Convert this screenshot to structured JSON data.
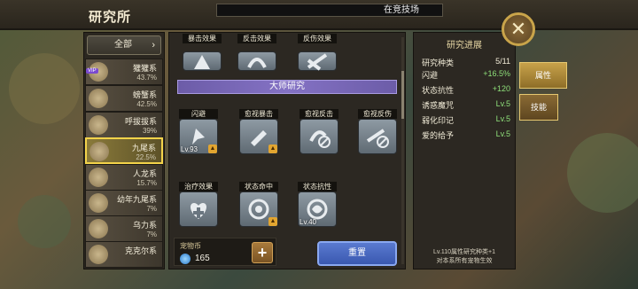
{
  "header": {
    "title": "研究所",
    "location": "在竞技场",
    "close_icon": "close-icon"
  },
  "sidebar": {
    "dropdown": {
      "label": "全部",
      "icon": "chevron-down-icon"
    },
    "items": [
      {
        "name": "獾獾系",
        "pct": "43.7%",
        "badge": "VIP"
      },
      {
        "name": "螃蟹系",
        "pct": "42.5%"
      },
      {
        "name": "呼拔拔系",
        "pct": "39%"
      },
      {
        "name": "九尾系",
        "pct": "22.5%",
        "selected": true
      },
      {
        "name": "人龙系",
        "pct": "15.7%"
      },
      {
        "name": "幼年九尾系",
        "pct": "7%"
      },
      {
        "name": "乌力系",
        "pct": "7%"
      },
      {
        "name": "克克尔系",
        "pct": ""
      }
    ]
  },
  "main": {
    "top_skills": [
      {
        "label": "暴击效果"
      },
      {
        "label": "反击效果"
      },
      {
        "label": "反伤效果"
      }
    ],
    "section_title": "大师研究",
    "row1": [
      {
        "label": "闪避",
        "level": "Lv.93",
        "thumb": true
      },
      {
        "label": "愈视暴击",
        "level": "",
        "thumb": true
      },
      {
        "label": "愈视反击",
        "level": "",
        "thumb": false
      },
      {
        "label": "愈视反伤",
        "level": "",
        "thumb": false
      }
    ],
    "row2": [
      {
        "label": "治疗效果",
        "level": "",
        "thumb": false
      },
      {
        "label": "状态命中",
        "level": "",
        "thumb": true
      },
      {
        "label": "状态抗性",
        "level": "Lv.40",
        "thumb": false
      }
    ],
    "currency": {
      "label": "宠物币",
      "value": "165",
      "icon": "gem-icon",
      "plus": "+"
    },
    "reset_label": "重置"
  },
  "progress": {
    "title": "研究进展",
    "rows": [
      {
        "key": "研究种类",
        "value": "5/11",
        "white": true
      },
      {
        "key": "闪避",
        "value": "+16.5%"
      },
      {
        "key": "状态抗性",
        "value": "+120"
      },
      {
        "key": "诱惑魔咒",
        "value": "Lv.5"
      },
      {
        "key": "弱化印记",
        "value": "Lv.5"
      },
      {
        "key": "爱的给予",
        "value": "Lv.5"
      }
    ],
    "note_line1": "Lv.110属性研究种类+1",
    "note_line2": "对本系所有宠物生效"
  },
  "tabs": [
    {
      "label": "属性",
      "active": true
    },
    {
      "label": "技能",
      "active": false
    }
  ]
}
